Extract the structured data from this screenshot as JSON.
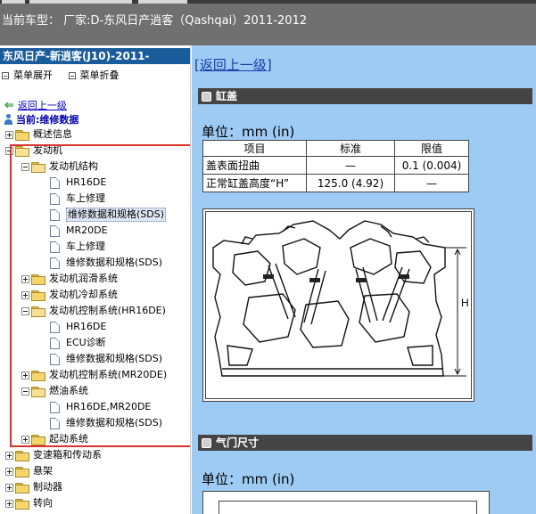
{
  "header": {
    "vehicle_line": "当前车型： 厂家:D-东风日产逍客（Qashqai）2011-2012"
  },
  "sidebar": {
    "title": "东风日产-新逍客(J10)-2011-",
    "expand_menu": "菜单展开",
    "collapse_menu": "菜单折叠",
    "back_link": "返回上一级",
    "current_label": "当前:维修数据",
    "tree": [
      {
        "label": "概述信息",
        "toggle": "plus",
        "icon": "folder",
        "level": 0
      },
      {
        "label": "发动机",
        "toggle": "minus",
        "icon": "folder-open",
        "level": 0
      },
      {
        "label": "发动机结构",
        "toggle": "minus",
        "icon": "folder-open",
        "level": 1
      },
      {
        "label": "HR16DE",
        "toggle": "",
        "icon": "document",
        "level": 2
      },
      {
        "label": "车上修理",
        "toggle": "",
        "icon": "document",
        "level": 2
      },
      {
        "label": "维修数据和规格(SDS)",
        "toggle": "",
        "icon": "document",
        "level": 2,
        "selected": true
      },
      {
        "label": "MR20DE",
        "toggle": "",
        "icon": "document",
        "level": 2
      },
      {
        "label": "车上修理",
        "toggle": "",
        "icon": "document",
        "level": 2
      },
      {
        "label": "维修数据和规格(SDS)",
        "toggle": "",
        "icon": "document",
        "level": 2
      },
      {
        "label": "发动机润滑系统",
        "toggle": "plus",
        "icon": "folder",
        "level": 1
      },
      {
        "label": "发动机冷却系统",
        "toggle": "plus",
        "icon": "folder",
        "level": 1
      },
      {
        "label": "发动机控制系统(HR16DE)",
        "toggle": "minus",
        "icon": "folder-open",
        "level": 1
      },
      {
        "label": "HR16DE",
        "toggle": "",
        "icon": "document",
        "level": 2
      },
      {
        "label": "ECU诊断",
        "toggle": "",
        "icon": "document",
        "level": 2
      },
      {
        "label": "维修数据和规格(SDS)",
        "toggle": "",
        "icon": "document",
        "level": 2
      },
      {
        "label": "发动机控制系统(MR20DE)",
        "toggle": "plus",
        "icon": "folder",
        "level": 1
      },
      {
        "label": "燃油系统",
        "toggle": "minus",
        "icon": "folder-open",
        "level": 1
      },
      {
        "label": "HR16DE,MR20DE",
        "toggle": "",
        "icon": "document",
        "level": 2
      },
      {
        "label": "维修数据和规格(SDS)",
        "toggle": "",
        "icon": "document",
        "level": 2
      },
      {
        "label": "起动系统",
        "toggle": "plus",
        "icon": "folder",
        "level": 1
      },
      {
        "label": "变速箱和传动系",
        "toggle": "plus",
        "icon": "folder",
        "level": 0
      },
      {
        "label": "悬架",
        "toggle": "plus",
        "icon": "folder",
        "level": 0
      },
      {
        "label": "制动器",
        "toggle": "plus",
        "icon": "folder",
        "level": 0
      },
      {
        "label": "转向",
        "toggle": "plus",
        "icon": "folder",
        "level": 0
      }
    ]
  },
  "main": {
    "return_link": "[返回上一级]",
    "section1": {
      "title": "缸盖",
      "unit": "单位：mm (in)",
      "table": {
        "headers": [
          "项目",
          "标准",
          "限值"
        ],
        "rows": [
          [
            "盖表面扭曲",
            "—",
            "0.1 (0.004)"
          ],
          [
            "正常缸盖高度“H”",
            "125.0 (4.92)",
            "—"
          ]
        ]
      },
      "figure_label": "H"
    },
    "section2": {
      "title": "气门尺寸",
      "unit": "单位：mm (in)"
    }
  },
  "colors": {
    "sidebar_header_bg": "#1a5c9b",
    "content_bg": "#9ecbf4",
    "section_header_bg": "#444444",
    "highlight_border": "#d8322e",
    "link": "#1a3ca8"
  }
}
